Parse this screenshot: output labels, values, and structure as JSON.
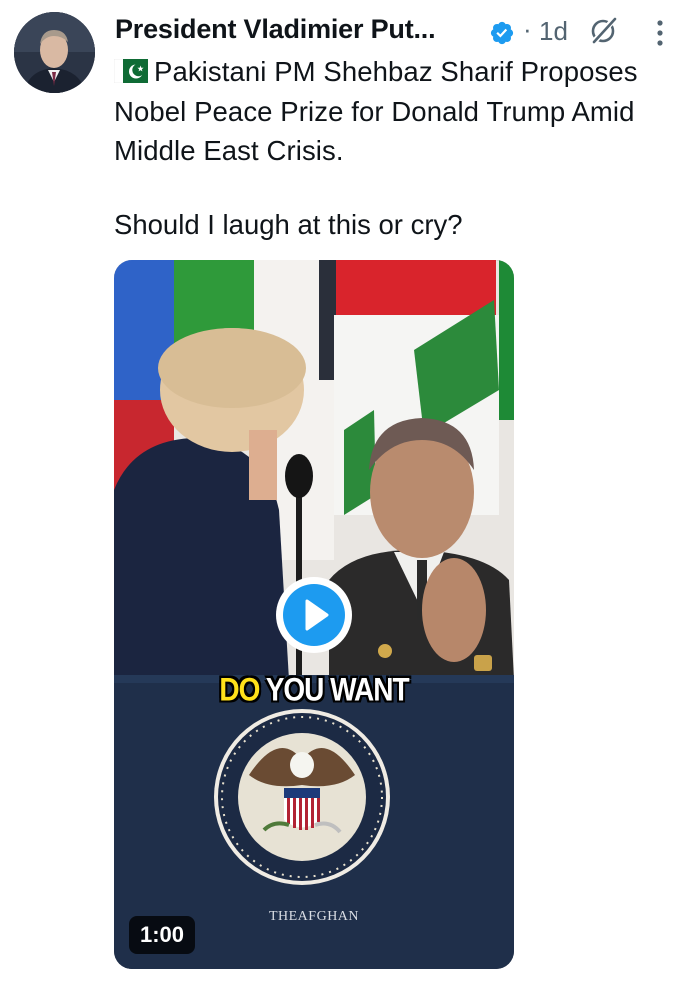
{
  "author": {
    "display_name": "President Vladimier Put...",
    "verified_icon": "verified-badge-icon",
    "dot": "·",
    "time": "1d",
    "grok_icon": "grok-icon",
    "more_icon": "more-vertical-icon"
  },
  "tweet": {
    "flag_icon": "pakistan-flag-icon",
    "text": "Pakistani PM Shehbaz Sharif Proposes Nobel Peace Prize for Donald Trump Amid Middle East Crisis.",
    "question": "Should I laugh at this or cry?"
  },
  "video": {
    "caption_highlight": "DO",
    "caption_rest": " YOU WANT",
    "watermark": "THEAFGHAN",
    "duration": "1:00",
    "play_icon": "play-icon"
  },
  "colors": {
    "accent": "#1d9bf0",
    "text": "#0f1419",
    "muted": "#536471"
  }
}
